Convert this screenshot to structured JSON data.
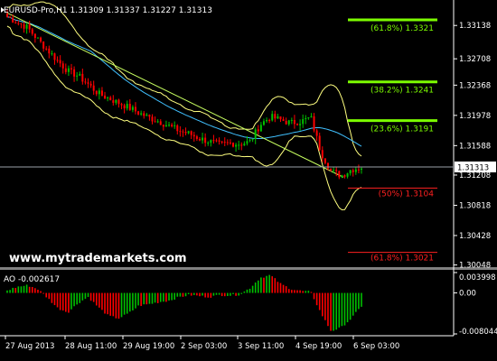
{
  "window": {
    "symbol_line": "EURUSD-Pro,H1  1.31309 1.31337 1.31227 1.31313",
    "watermark": "www.mytrademarkets.com"
  },
  "price_axis": {
    "labels": [
      "1.33138",
      "1.32708",
      "1.32368",
      "1.31978",
      "1.31588",
      "1.31313",
      "1.31208",
      "1.30818",
      "1.30428",
      "1.30048"
    ],
    "current": "1.31313"
  },
  "fib_levels": [
    {
      "label": "(61.8%) 1.3321",
      "price": 1.3321,
      "color": "#7cfc00"
    },
    {
      "label": "(38.2%) 1.3241",
      "price": 1.3241,
      "color": "#7cfc00"
    },
    {
      "label": "(23.6%) 1.3191",
      "price": 1.3191,
      "color": "#7cfc00"
    },
    {
      "label": "(50%) 1.3104",
      "price": 1.3104,
      "color": "#ff2020"
    },
    {
      "label": "(61.8%) 1.3021",
      "price": 1.3021,
      "color": "#ff2020"
    }
  ],
  "oscillator": {
    "title": "AO -0.002617",
    "axis_labels": [
      "0.003998",
      "0.00",
      "-0.008044"
    ]
  },
  "time_axis": [
    "27 Aug 2013",
    "28 Aug 11:00",
    "29 Aug 19:00",
    "2 Sep 03:00",
    "3 Sep 11:00",
    "4 Sep 19:00",
    "6 Sep 03:00"
  ],
  "colors": {
    "background": "#000000",
    "bull": "#00c000",
    "bear": "#ff0000",
    "bands": "#ffff80",
    "ma": "#40c0ff",
    "trendline": "#c8ff60",
    "axis_text": "#ffffff",
    "watermark": "#ffffff"
  },
  "chart_data": {
    "type": "candlestick",
    "symbol": "EURUSD-Pro",
    "timeframe": "H1",
    "ohlc_last": {
      "open": 1.31309,
      "high": 1.31337,
      "low": 1.31227,
      "close": 1.31313
    },
    "ylim": [
      1.3002,
      1.3335
    ],
    "close_path": [
      1.3325,
      1.3318,
      1.3311,
      1.3296,
      1.3282,
      1.3268,
      1.3255,
      1.3249,
      1.3238,
      1.3226,
      1.322,
      1.3214,
      1.3208,
      1.3201,
      1.3195,
      1.319,
      1.3184,
      1.3178,
      1.3174,
      1.3168,
      1.3164,
      1.316,
      1.3162,
      1.3161,
      1.3164,
      1.3186,
      1.3196,
      1.3192,
      1.3188,
      1.319,
      1.3195,
      1.315,
      1.3126,
      1.312,
      1.3128,
      1.3131
    ],
    "ao_path": [
      0.0005,
      0.0012,
      0.0015,
      0.0008,
      -0.001,
      -0.003,
      -0.0038,
      -0.002,
      -0.0008,
      -0.0028,
      -0.0045,
      -0.005,
      -0.004,
      -0.0025,
      -0.0022,
      -0.0018,
      -0.0015,
      -0.0008,
      -0.0004,
      -0.0006,
      -0.0008,
      -0.0004,
      -0.0005,
      -0.0003,
      0.001,
      0.003,
      0.0035,
      0.0018,
      0.0008,
      0.0004,
      0.0002,
      -0.004,
      -0.0075,
      -0.0068,
      -0.005,
      -0.0026
    ],
    "ao_ylim": [
      -0.008044,
      0.003998
    ]
  }
}
